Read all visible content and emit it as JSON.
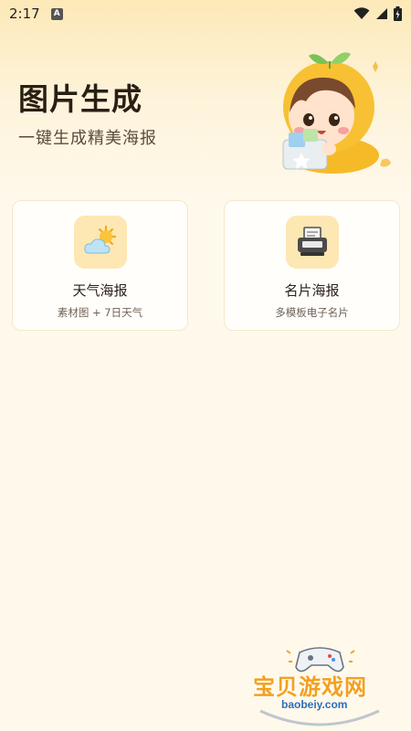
{
  "status_bar": {
    "time": "2:17",
    "badge": "A"
  },
  "hero": {
    "title": "图片生成",
    "subtitle": "一键生成精美海报"
  },
  "cards": [
    {
      "title": "天气海报",
      "desc": "素材图 + 7日天气",
      "icon": "weather-sun-cloud-icon"
    },
    {
      "title": "名片海报",
      "desc": "多模板电子名片",
      "icon": "card-printer-icon"
    }
  ],
  "watermark": {
    "text": "宝贝游戏网",
    "url": "baobeiy.com"
  },
  "colors": {
    "background": "#fff9ec",
    "hero_top": "#fde9b8",
    "icon_box": "#fde7b3",
    "title": "#2a1f14",
    "watermark_orange": "#f4a01c"
  }
}
